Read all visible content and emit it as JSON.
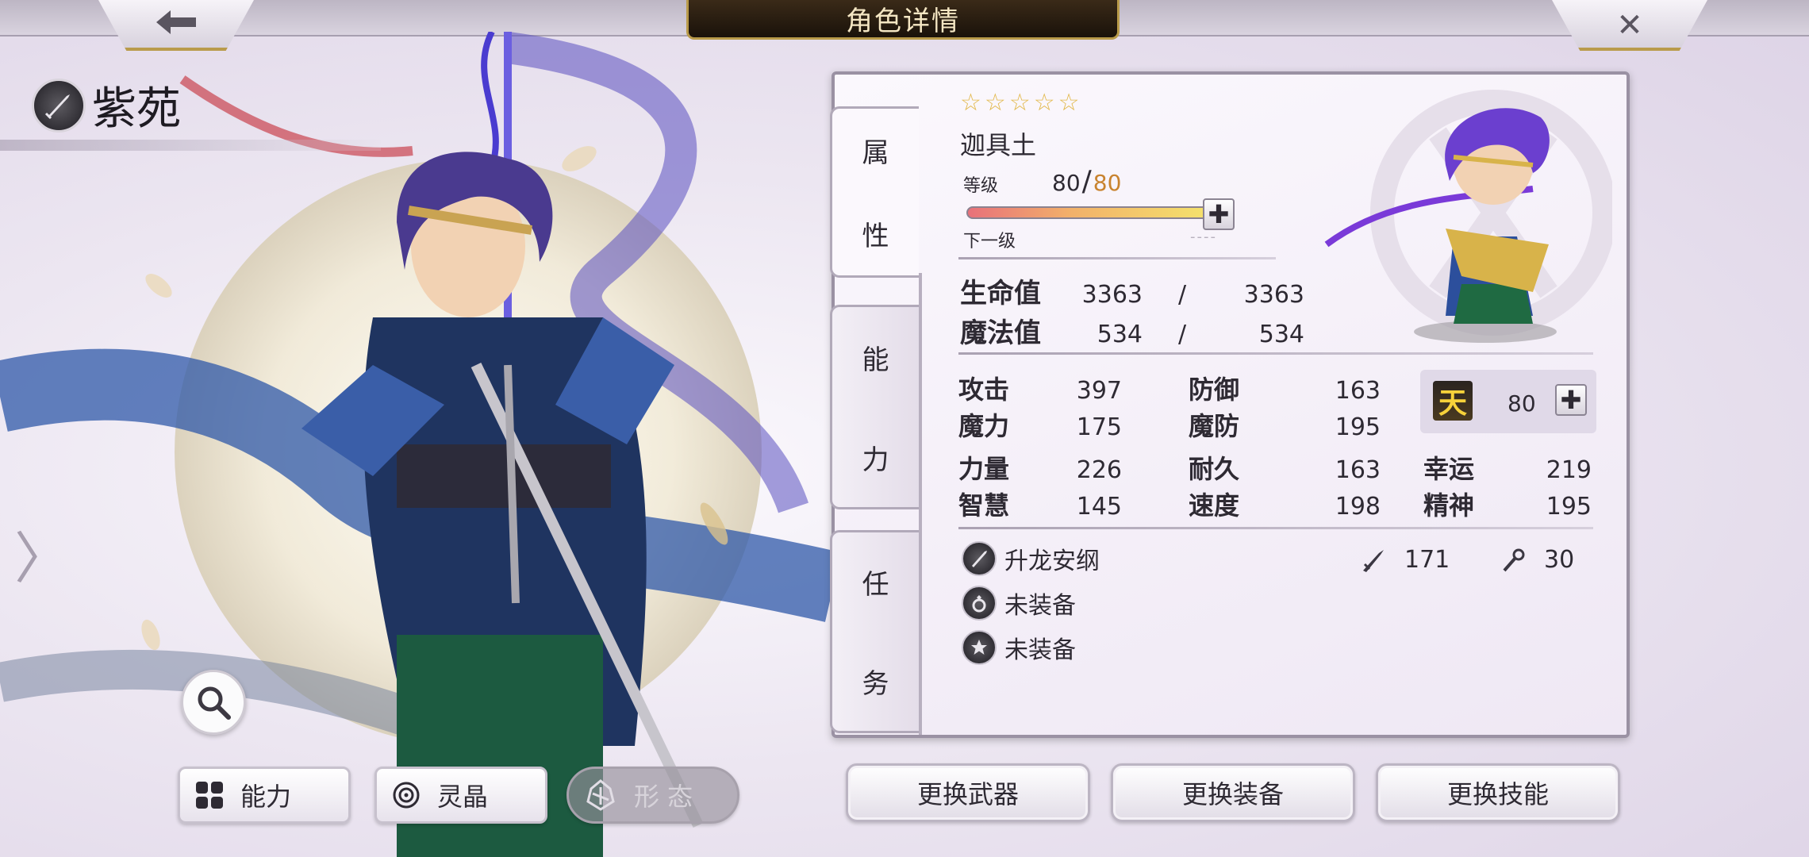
{
  "header": {
    "title": "角色详情",
    "back_glyph": "🡐",
    "close_glyph": "✕"
  },
  "character": {
    "name": "紫苑",
    "class_icon": "sword-class-icon"
  },
  "left_tabs": [
    {
      "label": "能力",
      "icon": "ability-grid-icon"
    },
    {
      "label": "灵晶",
      "icon": "crystal-icon"
    },
    {
      "label": "形 态",
      "icon": "form-icon",
      "disabled": true
    }
  ],
  "side_tabs": [
    {
      "chars": [
        "属",
        "性"
      ]
    },
    {
      "chars": [
        "能",
        "力"
      ]
    },
    {
      "chars": [
        "任",
        "务"
      ]
    }
  ],
  "unit": {
    "rarity_stars": 5,
    "star_glyph": "☆",
    "name": "迦具土",
    "level_label": "等级",
    "level": "80",
    "level_slash": "/",
    "level_max": "80",
    "level_progress": 1.0,
    "next_label": "下一级",
    "next_value": "----"
  },
  "vitals": {
    "hp_label": "生命值",
    "hp": "3363",
    "hp_max": "3363",
    "mp_label": "魔法值",
    "mp": "534",
    "mp_max": "534",
    "slash": "/"
  },
  "stats": {
    "atk_label": "攻击",
    "atk": "397",
    "def_label": "防御",
    "def": "163",
    "mag_label": "魔力",
    "mag": "175",
    "mdef_label": "魔防",
    "mdef": "195",
    "str_label": "力量",
    "str": "226",
    "end_label": "耐久",
    "end": "163",
    "luck_label": "幸运",
    "luck": "219",
    "int_label": "智慧",
    "int": "145",
    "spd_label": "速度",
    "spd": "198",
    "spirit_label": "精神",
    "spirit": "195"
  },
  "rank": {
    "badge": "天",
    "value": "80"
  },
  "equipment": {
    "weapon_name": "升龙安纲",
    "weapon_atk": "171",
    "weapon_mag": "30",
    "accessory": "未装备",
    "armor": "未装备"
  },
  "actions": {
    "change_weapon": "更换武器",
    "change_equip": "更换装备",
    "change_skill": "更换技能"
  },
  "colors": {
    "accent_gold": "#b99b4a",
    "level_max": "#c8832f",
    "rank_badge": "#f7d23a"
  }
}
